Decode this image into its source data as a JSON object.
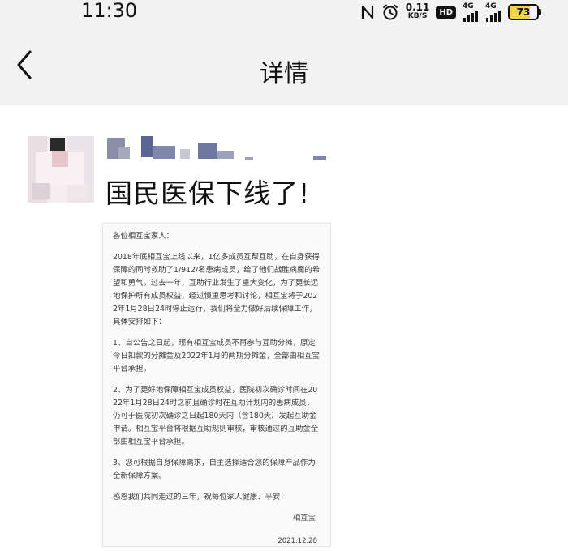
{
  "status_bar": {
    "time": "11:30",
    "speed_value": "0.11",
    "speed_unit": "KB/S",
    "hd": "HD",
    "net1": "4G",
    "net2": "4G",
    "battery": "73"
  },
  "nav": {
    "title": "详情"
  },
  "post": {
    "text": "国民医保下线了!"
  },
  "notice": {
    "greeting": "各位相互宝家人：",
    "paragraphs": [
      "2018年底相互宝上线以来，1亿多成员互帮互助，在自身获得保障的同时救助了1/912/名患病成员，给了他们战胜病魔的希望和勇气。过去一年，互助行业发生了重大变化，为了更长远地保护所有成员权益，经过慎重思考和讨论，相互宝将于2022年1月28日24时停止运行，我们将全力做好后续保障工作，具体安排如下：",
      "1、自公告之日起，现有相互宝成员不再参与互助分摊，原定今日扣款的分摊金及2022年1月的两期分摊金，全部由相互宝平台承担。",
      "2、为了更好地保障相互宝成员权益，医院初次确诊时间在2022年1月28日24时之前且确诊时在互助计划内的患病成员，仍可于医院初次确诊之日起180天内（含180天）发起互助金申请。相互宝平台将根据互助规则审核，审核通过的互助金全部由相互宝平台承担。",
      "3、您可根据自身保障需求，自主选择适合您的保障产品作为全新保障方案。",
      "感恩我们共同走过的三年，祝每位家人健康、平安！"
    ],
    "signature": "相互宝",
    "date": "2021.12.28"
  },
  "colors": {
    "header_bg": "#f2f2f2",
    "text": "#111111",
    "battery_fill": "#f0d34a"
  },
  "icons": {
    "back": "chevron-left-icon",
    "nfc": "nfc-icon",
    "alarm": "alarm-icon"
  }
}
